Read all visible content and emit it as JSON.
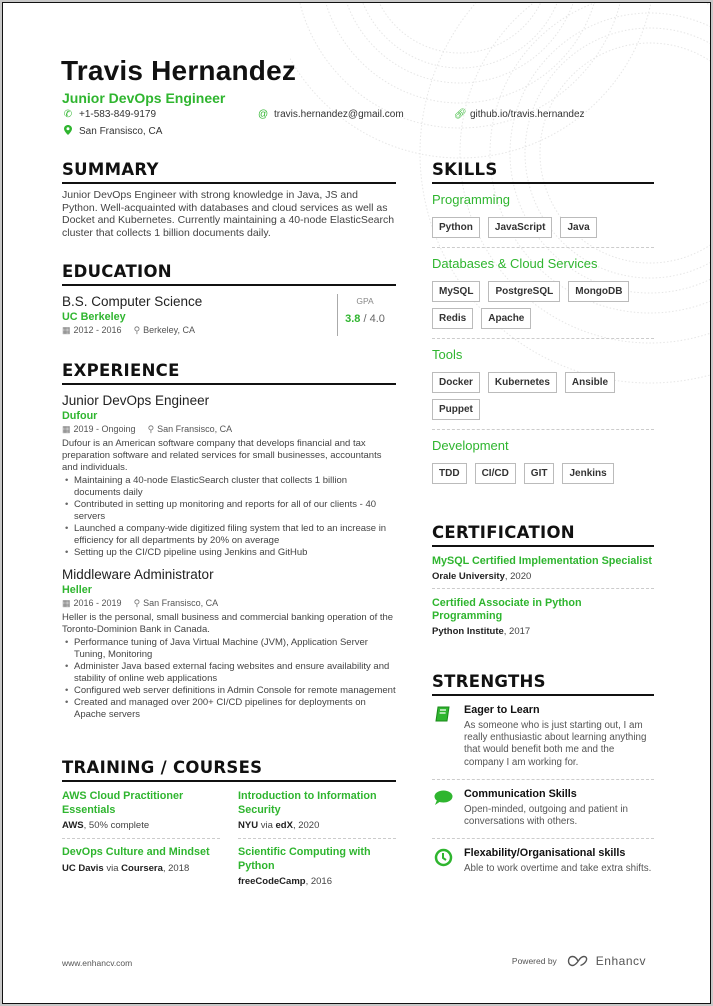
{
  "header": {
    "name": "Travis Hernandez",
    "title": "Junior DevOps Engineer",
    "phone": "+1-583-849-9179",
    "email": "travis.hernandez@gmail.com",
    "website": "github.io/travis.hernandez",
    "location": "San Fransisco, CA",
    "icons": {
      "phone": "phone-icon",
      "email": "at-icon",
      "website": "link-icon",
      "location": "map-pin-icon"
    }
  },
  "summary": {
    "heading": "SUMMARY",
    "text": "Junior DevOps Engineer with strong knowledge in Java, JS and Python. Well-acquainted with databases and cloud services as well as Docket and Kubernetes. Currently maintaining a 40-node ElasticSearch cluster that collects 1 billion documents daily."
  },
  "education": {
    "heading": "EDUCATION",
    "degree": "B.S. Computer Science",
    "school": "UC Berkeley",
    "dates": "2012 - 2016",
    "location": "Berkeley, CA",
    "gpa_label": "GPA",
    "gpa": "3.8",
    "gpa_max": "/ 4.0"
  },
  "experience": {
    "heading": "EXPERIENCE",
    "jobs": [
      {
        "role": "Junior DevOps Engineer",
        "company": "Dufour",
        "dates": "2019 - Ongoing",
        "location": "San Fransisco, CA",
        "description": "Dufour is an American software company that develops financial and tax preparation software and related services for small businesses, accountants and individuals.",
        "bullets": [
          "Maintaining a 40-node ElasticSearch cluster that collects 1 billion documents daily",
          "Contributed in setting up monitoring and reports for all of our clients - 40 servers",
          "Launched a company-wide digitized filing system that led to an increase in efficiency for all departments by 20% on average",
          "Setting up the CI/CD pipeline using Jenkins and GitHub"
        ]
      },
      {
        "role": "Middleware Administrator",
        "company": "Heller",
        "dates": "2016 - 2019",
        "location": "San Fransisco, CA",
        "description": "Heller is the personal, small business and commercial banking operation of the Toronto-Dominion Bank in Canada.",
        "bullets": [
          "Performance tuning of Java Virtual Machine (JVM), Application Server Tuning, Monitoring",
          "Administer Java based external facing websites and ensure availability and stability of online web applications",
          "Configured web server definitions in Admin Console for remote management",
          "Created and managed over 200+ CI/CD pipelines for deployments on Apache servers"
        ]
      }
    ]
  },
  "training": {
    "heading": "TRAINING / COURSES",
    "courses": [
      {
        "title": "AWS Cloud Practitioner Essentials",
        "org": "AWS",
        "via": "",
        "provider": "",
        "detail": ", 50% complete"
      },
      {
        "title": "Introduction to Information Security",
        "org": "NYU",
        "via": " via ",
        "provider": "edX",
        "detail": ", 2020"
      },
      {
        "title": "DevOps Culture and Mindset",
        "org": "UC Davis",
        "via": " via ",
        "provider": "Coursera",
        "detail": ", 2018"
      },
      {
        "title": "Scientific Computing with Python",
        "org": "freeCodeCamp",
        "via": "",
        "provider": "",
        "detail": ", 2016"
      }
    ]
  },
  "skills": {
    "heading": "SKILLS",
    "categories": [
      {
        "name": "Programming",
        "items": [
          "Python",
          "JavaScript",
          "Java"
        ]
      },
      {
        "name": "Databases & Cloud Services",
        "items": [
          "MySQL",
          "PostgreSQL",
          "MongoDB",
          "Redis",
          "Apache"
        ]
      },
      {
        "name": "Tools",
        "items": [
          "Docker",
          "Kubernetes",
          "Ansible",
          "Puppet"
        ]
      },
      {
        "name": "Development",
        "items": [
          "TDD",
          "CI/CD",
          "GIT",
          "Jenkins"
        ]
      }
    ]
  },
  "certification": {
    "heading": "CERTIFICATION",
    "items": [
      {
        "title": "MySQL Certified Implementation Specialist",
        "issuer": "Orale University",
        "year": ", 2020"
      },
      {
        "title": "Certified Associate in Python Programming",
        "issuer": "Python Institute",
        "year": ", 2017"
      }
    ]
  },
  "strengths": {
    "heading": "STRENGTHS",
    "items": [
      {
        "icon": "book-icon",
        "title": "Eager to Learn",
        "text": "As someone who is just starting out, I am really enthusiastic about learning anything that would benefit both me and the company I am working for."
      },
      {
        "icon": "speech-bubble-icon",
        "title": "Communication Skills",
        "text": "Open-minded, outgoing and patient in conversations with others."
      },
      {
        "icon": "clock-icon",
        "title": "Flexability/Organisational skills",
        "text": "Able to work overtime and take extra shifts."
      }
    ]
  },
  "footer": {
    "website": "www.enhancv.com",
    "powered_by": "Powered by",
    "brand": "Enhancv"
  },
  "colors": {
    "accent": "#2fb52f",
    "text": "#222222"
  }
}
